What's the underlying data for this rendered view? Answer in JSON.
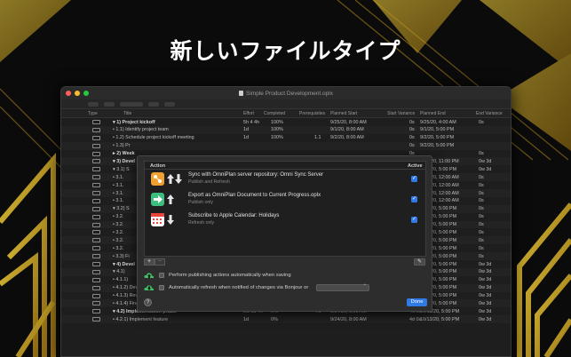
{
  "headline": "新しいファイルタイプ",
  "window": {
    "title": "Simple Product Development.oplx",
    "traffic_colors": [
      "#ff5f57",
      "#febc2e",
      "#28c840"
    ]
  },
  "columns": [
    "Type",
    "Title",
    "Effort",
    "Completed",
    "Prerequisites",
    "Planned Start",
    "Start Variance",
    "Planned End",
    "End Variance"
  ],
  "rows": [
    {
      "title": "▾ 1)  Project kickoff",
      "effort": "5h 4 4h",
      "completed": "100%",
      "prereq": "",
      "start": "9/25/20, 8:00 AM",
      "svar": "0s",
      "end": "9/25/20, 4:00 AM",
      "evar": "0s",
      "bold": true
    },
    {
      "title": "• 1.1)  Identify project team",
      "effort": "1d",
      "completed": "100%",
      "prereq": "",
      "start": "9/1/20, 8:00 AM",
      "svar": "0s",
      "end": "9/1/20, 5:00 PM",
      "evar": "",
      "bold": false
    },
    {
      "title": "• 1.2)  Schedule project kickoff meeting",
      "effort": "1d",
      "completed": "100%",
      "prereq": "1.1",
      "start": "9/2/20, 8:00 AM",
      "svar": "0s",
      "end": "9/2/20, 5:00 PM",
      "evar": "",
      "bold": false
    },
    {
      "title": "• 1.3)  Pr",
      "effort": "",
      "completed": "",
      "prereq": "",
      "start": "",
      "svar": "0s",
      "end": "9/2/20, 5:00 PM",
      "evar": "",
      "bold": false
    },
    {
      "title": "▸ 2)  Week",
      "effort": "",
      "completed": "",
      "prereq": "",
      "start": "",
      "svar": "0s",
      "end": "",
      "evar": "0s",
      "bold": true
    },
    {
      "title": "▾ 3)  Devel",
      "effort": "",
      "completed": "",
      "prereq": "",
      "start": "",
      "svar": "0s",
      "end": "10/5/20, 11:00 PM",
      "evar": "0w 3d",
      "bold": true
    },
    {
      "title": "▾ 3.1)  S",
      "effort": "",
      "completed": "",
      "prereq": "",
      "start": "",
      "svar": "0s",
      "end": "9/24/20, 5:00 PM",
      "evar": "0w 3d",
      "bold": false
    },
    {
      "title": "• 3.1.",
      "effort": "",
      "completed": "",
      "prereq": "",
      "start": "",
      "svar": "0s",
      "end": "9/25/20, 12:00 AM",
      "evar": "0s",
      "bold": false
    },
    {
      "title": "• 3.1.",
      "effort": "",
      "completed": "",
      "prereq": "",
      "start": "",
      "svar": "0s",
      "end": "9/25/20, 12:00 AM",
      "evar": "0s",
      "bold": false
    },
    {
      "title": "• 3.1.",
      "effort": "",
      "completed": "",
      "prereq": "",
      "start": "",
      "svar": "0s",
      "end": "9/25/20, 12:00 AM",
      "evar": "0s",
      "bold": false
    },
    {
      "title": "• 3.1.",
      "effort": "",
      "completed": "",
      "prereq": "",
      "start": "",
      "svar": "0s",
      "end": "9/25/20, 12:00 AM",
      "evar": "0s",
      "bold": false
    },
    {
      "title": "▾ 3.2)  S",
      "effort": "",
      "completed": "",
      "prereq": "",
      "start": "",
      "svar": "0s",
      "end": "9/28/20, 5:00 PM",
      "evar": "0s",
      "bold": false
    },
    {
      "title": "• 3.2.",
      "effort": "",
      "completed": "",
      "prereq": "",
      "start": "",
      "svar": "0s",
      "end": "9/28/20, 5:00 PM",
      "evar": "0s",
      "bold": false
    },
    {
      "title": "• 3.2.",
      "effort": "",
      "completed": "",
      "prereq": "",
      "start": "",
      "svar": "0s",
      "end": "9/28/20, 5:00 PM",
      "evar": "0s",
      "bold": false
    },
    {
      "title": "• 3.2.",
      "effort": "",
      "completed": "",
      "prereq": "",
      "start": "",
      "svar": "0s",
      "end": "9/28/20, 5:00 PM",
      "evar": "0s",
      "bold": false
    },
    {
      "title": "• 3.2.",
      "effort": "",
      "completed": "",
      "prereq": "",
      "start": "",
      "svar": "0s",
      "end": "9/28/20, 5:00 PM",
      "evar": "0s",
      "bold": false
    },
    {
      "title": "• 3.2.",
      "effort": "",
      "completed": "",
      "prereq": "",
      "start": "",
      "svar": "0s",
      "end": "9/28/20, 5:00 PM",
      "evar": "0s",
      "bold": false
    },
    {
      "title": "• 3.3)  Fi",
      "effort": "",
      "completed": "",
      "prereq": "",
      "start": "",
      "svar": "0s",
      "end": "10/5/20, 5:00 PM",
      "evar": "0s",
      "bold": false
    },
    {
      "title": "▾ 4)  Devel",
      "effort": "",
      "completed": "",
      "prereq": "",
      "start": "",
      "svar": "0s",
      "end": "10/6/20, 5:00 PM",
      "evar": "0w 3d",
      "bold": true
    },
    {
      "title": "▾ 4.1)",
      "effort": "",
      "completed": "",
      "prereq": "",
      "start": "",
      "svar": "0s",
      "end": "10/7/20, 5:00 PM",
      "evar": "0w 3d",
      "bold": false
    },
    {
      "title": "• 4.1.1)",
      "effort": "",
      "completed": "",
      "prereq": "",
      "start": "",
      "svar": "0s",
      "end": "10/7/20, 5:00 PM",
      "evar": "0w 3d",
      "bold": false
    },
    {
      "title": "• 4.1.2)  Develop Final User Interface",
      "effort": "",
      "completed": "",
      "prereq": "",
      "start": "",
      "svar": "0s",
      "end": "10/7/20, 5:00 PM",
      "evar": "0w 3d",
      "bold": false
    },
    {
      "title": "• 4.1.3)  Review feature mockups",
      "effort": "8h",
      "completed": "0%",
      "prereq": "4.1.2",
      "start": "9/22/20, 9:00 AM",
      "svar": "4d 0s",
      "end": "10/8/20, 5:00 PM",
      "evar": "0w 3d",
      "bold": false
    },
    {
      "title": "• 4.1.4)  Finalize feature mockups",
      "effort": "1d",
      "completed": "0%",
      "prereq": "4.1.3",
      "start": "9/23/20, 8:00 AM",
      "svar": "4d 0s",
      "end": "10/9/20, 5:00 PM",
      "evar": "0w 3d",
      "bold": false
    },
    {
      "title": "▾ 4.2)  Implementation phase",
      "effort": "0w 1d 4h",
      "completed": "0%",
      "prereq": "4.1",
      "start": "9/24/20, 8:00 AM",
      "svar": "4d 0s",
      "end": "10/13/20, 5:00 PM",
      "evar": "0w 3d",
      "bold": true
    },
    {
      "title": "• 4.2.1)  Implement feature",
      "effort": "1d",
      "completed": "0%",
      "prereq": "",
      "start": "9/24/20, 8:00 AM",
      "svar": "4d 0s",
      "end": "10/13/20, 5:00 PM",
      "evar": "0w 3d",
      "bold": false
    }
  ],
  "sheet": {
    "col_action": "Action",
    "col_active": "Active",
    "actions": [
      {
        "title": "Sync with OmniPlan server repository: Omni Sync Server",
        "subtitle": "Publish and Refresh",
        "icon": "sync-server-icon",
        "icon_color": "#f0a030",
        "active": true
      },
      {
        "title": "Export as OmniPlan Document to Current Progress.oplx",
        "subtitle": "Publish only",
        "icon": "export-document-icon",
        "icon_color": "#3fbf7f",
        "active": true
      },
      {
        "title": "Subscribe to Apple Calendar: Holidays",
        "subtitle": "Refresh only",
        "icon": "calendar-icon",
        "icon_color": "#e8453c",
        "active": true
      }
    ],
    "add_label": "+",
    "remove_label": "−",
    "edit_icon": "pencil-icon",
    "option_auto_publish": "Perform publishing actions automatically when saving",
    "option_auto_refresh": "Automatically refresh when notified of changes via Bonjour or",
    "refresh_popup_value": "",
    "help_label": "?",
    "done_label": "Done"
  },
  "colors": {
    "accent": "#2f7ae5",
    "gold": "#e7b928"
  }
}
